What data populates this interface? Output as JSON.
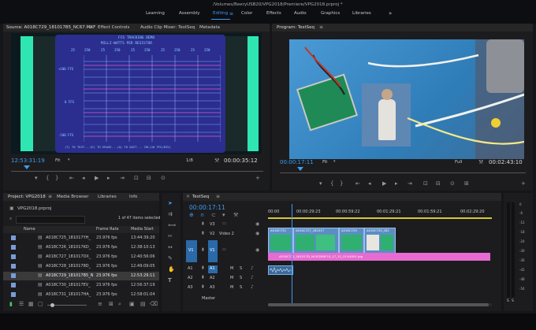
{
  "window_title": "/Volumes/BeeryUSB20/VPG2018/Premiere/VPG2018.prproj *",
  "workspaces": [
    "Learning",
    "Assembly",
    "Editing",
    "Color",
    "Effects",
    "Audio",
    "Graphics",
    "Libraries"
  ],
  "workspace_active": "Editing",
  "workspace_more": "»",
  "source_panel": {
    "tabs": [
      "Source: A018C729_181017B5_NC67.MXF",
      "Effect Controls",
      "Audio Clip Mixer: TestSeq",
      "Metadata"
    ],
    "timecode": "12:53:31:19",
    "fit": "Fit",
    "fraction": "1/8",
    "duration": "00:00:35:12",
    "screen": {
      "title": "FCS TRACKING DEMO",
      "subtitle": "MILLI-WATTS PER RESISTOR",
      "ticks": [
        "25",
        "250",
        "25",
        "250",
        "25",
        "250",
        "25",
        "250",
        "25",
        "250"
      ],
      "y_labels": [
        "+100 FFS",
        "0 FFS",
        "-100 FFS"
      ],
      "footer": "(T) TO TEST...(E) TO ERASE...(Q) TO QUIT...  CRL(10 FFS/DIV)"
    }
  },
  "program_panel": {
    "tab": "Program: TestSeq",
    "timecode": "00:00:17:11",
    "fit": "Fit",
    "quality": "Full",
    "duration": "00:02:43:10"
  },
  "project_panel": {
    "tabs": [
      "Project: VPG2018",
      "Media Browser",
      "Libraries",
      "Info"
    ],
    "file": "VPG2018.prproj",
    "selection": "1 of 47 items selected",
    "columns": [
      "Name",
      "Frame Rate",
      "Media Start"
    ],
    "rows": [
      {
        "name": "A018C725_181017YH_",
        "rate": "23.976 fps",
        "start": "13:44:39:20",
        "color": "#7a9cd6"
      },
      {
        "name": "A018C726_181017KD_",
        "rate": "23.976 fps",
        "start": "12:38:10:13",
        "color": "#7a9cd6"
      },
      {
        "name": "A018C727_181017DX_",
        "rate": "23.976 fps",
        "start": "12:40:56:06",
        "color": "#7a9cd6"
      },
      {
        "name": "A018C728_1810178D_",
        "rate": "23.976 fps",
        "start": "12:49:09:05",
        "color": "#7a9cd6"
      },
      {
        "name": "A018C729_181017B5_N",
        "rate": "23.976 fps",
        "start": "12:53:29:11",
        "color": "#7a9cd6"
      },
      {
        "name": "A018C730_181017EV_",
        "rate": "23.976 fps",
        "start": "12:56:37:19",
        "color": "#7a9cd6"
      },
      {
        "name": "A018C731_181017HA_",
        "rate": "23.976 fps",
        "start": "12:58:01:04",
        "color": "#7a9cd6"
      }
    ]
  },
  "timeline": {
    "tab": "TestSeq",
    "timecode": "00:00:17:11",
    "ruler": [
      "00:00",
      "00:00:29:23",
      "00:00:59:22",
      "00:01:29:21",
      "00:01:59:21",
      "00:02:29:20"
    ],
    "tracks": [
      {
        "id": "V3",
        "src": "",
        "name": ""
      },
      {
        "id": "V2",
        "src": "",
        "name": "Video 2"
      },
      {
        "id": "V1",
        "src": "V1",
        "name": ""
      },
      {
        "id": "A1",
        "src": "A1",
        "name": ""
      },
      {
        "id": "A2",
        "src": "A2",
        "name": ""
      },
      {
        "id": "A3",
        "src": "A3",
        "name": ""
      },
      {
        "id": "Master",
        "src": "",
        "name": "Master"
      }
    ],
    "clips_v2": [
      "A018C732",
      "A018C727_181017",
      "A018C729",
      "A018C730_181"
    ],
    "clip_v1": "A018C732_181017D_NC67|MXF15_17_12_15.04001.jpg"
  },
  "meter_labels": [
    "0",
    "-6",
    "-12",
    "-18",
    "-24",
    "-30",
    "-36",
    "-42",
    "-48",
    "-54"
  ],
  "tools": [
    "selection-tool",
    "track-select-tool",
    "ripple-edit-tool",
    "razor-tool",
    "slip-tool",
    "pen-tool",
    "hand-tool",
    "type-tool"
  ],
  "colors": {
    "accent": "#3d9bf0",
    "screen_bg": "#2b2e8e",
    "clip_pink": "#e76bd1",
    "playhead": "#3d9bf0",
    "track_blue": "#2a6aa8"
  }
}
